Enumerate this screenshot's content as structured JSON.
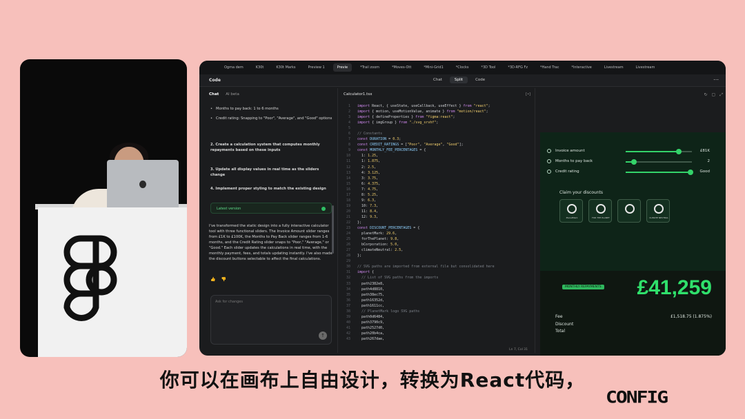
{
  "browser_tabs": [
    "Ogma dem",
    "K30t",
    "K30t Marks",
    "Preview 1",
    "Previe",
    "*Trail zoom",
    "*Moves-Ott",
    "*Mini-Grid1",
    "*Clocks",
    "*3D Tool",
    "*3D-RFG Fz",
    "*Hand Trac",
    "*Interactive",
    "Livestream",
    "Livestream"
  ],
  "app": {
    "title": "Code",
    "view_tabs": [
      "Chat",
      "Split",
      "Code"
    ],
    "active_view": "Split"
  },
  "chat": {
    "tabs": [
      "Chat",
      "AI beta"
    ],
    "bullets": [
      "Months to pay back: 1 to 6 months",
      "Credit rating: Snapping to \"Poor\", \"Average\", and \"Good\" options"
    ],
    "steps": [
      "2. Create a calculation system that computes monthly repayments based on these inputs",
      "3. Update all display values in real time as the sliders change",
      "4. Implement proper styling to match the existing design"
    ],
    "latest_version": "Latest version",
    "reply": "I've transformed the static design into a fully interactive calculator tool with three functional sliders. The Invoice Amount slider ranges from £1K to £100K, the Months to Pay Back slider ranges from 1-6 months, and the Credit Rating slider snaps to \"Poor,\" \"Average,\" or \"Good.\" Each slider updates the calculations in real time, with the monthly payment, fees, and totals updating instantly. I've also made the discount buttons selectable to affect the final calculations.",
    "input_placeholder": "Ask for changes"
  },
  "code": {
    "filename": "Calculator1.tsx",
    "status": "Ln 7, Col 31"
  },
  "calculator": {
    "sliders": [
      {
        "label": "Invoice amount",
        "value": "£81K",
        "fraction": 0.8
      },
      {
        "label": "Months to pay back",
        "value": "2",
        "fraction": 0.12
      },
      {
        "label": "Credit rating",
        "value": "Good",
        "fraction": 0.98
      }
    ],
    "claim_title": "Claim your discounts",
    "discounts": [
      "PlanetMark",
      "FOR THE PLANET",
      "",
      "CLIMATE NEUTRAL"
    ],
    "monthly_label": "MONTHLY REPAYMENTS",
    "monthly_value": "£41,259",
    "fee_label": "Fee",
    "fee_value": "£1,518.75 (1.875%)",
    "discount_label": "Discount",
    "total_label": "Total"
  },
  "subtitle": "你可以在画布上自由设计，转换为React代码，",
  "brand": "CONFIG"
}
